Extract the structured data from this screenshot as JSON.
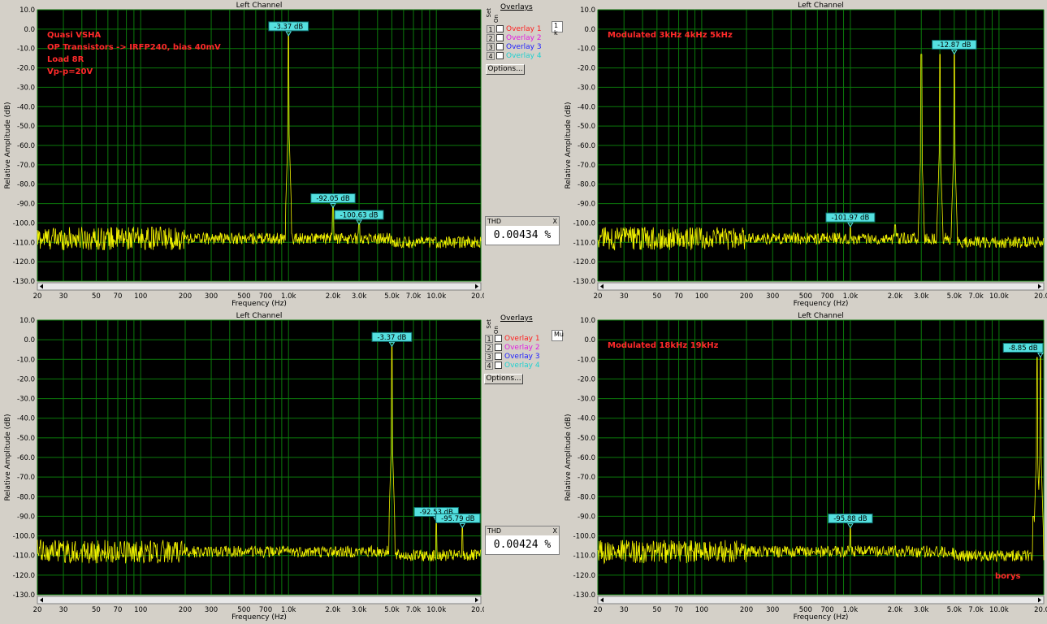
{
  "colors": {
    "plot_bg": "#000000",
    "grid": "#0b7a0b",
    "trace": "#f0f000",
    "marker": "#55e0e0",
    "annotation": "#ff2a2a"
  },
  "overlays": {
    "title": "Overlays",
    "set_label": "Set",
    "on_label": "On",
    "items": [
      {
        "num": "1",
        "label": "Overlay 1",
        "color": "#ff2020"
      },
      {
        "num": "2",
        "label": "Overlay 2",
        "color": "#e020e0"
      },
      {
        "num": "3",
        "label": "Overlay 3",
        "color": "#2020ff"
      },
      {
        "num": "4",
        "label": "Overlay 4",
        "color": "#20d0d0"
      }
    ],
    "options_label": "Options..."
  },
  "thd_top": {
    "label": "THD",
    "value": "0.00434 %",
    "close": "X"
  },
  "thd_bottom": {
    "label": "THD",
    "value": "0.00424 %",
    "close": "X"
  },
  "stub_top": "1 k",
  "stub_bottom": "Mu",
  "chart_data": [
    {
      "type": "line",
      "title": "Left Channel",
      "xlabel": "Frequency (Hz)",
      "ylabel": "Relative Amplitude (dB)",
      "xscale": "log",
      "xlim": [
        20,
        20000
      ],
      "ylim": [
        -130,
        10
      ],
      "xticks": [
        "20",
        "30",
        "50",
        "70",
        "100",
        "200",
        "300",
        "500",
        "700",
        "1.0k",
        "2.0k",
        "3.0k",
        "5.0k",
        "7.0k",
        "10.0k",
        "20.0k"
      ],
      "yticks": [
        "10.0",
        "0.0",
        "-10.0",
        "-20.0",
        "-30.0",
        "-40.0",
        "-50.0",
        "-60.0",
        "-70.0",
        "-80.0",
        "-90.0",
        "-100.0",
        "-110.0",
        "-120.0",
        "-130.0"
      ],
      "annotations": [
        "Quasi VSHA",
        "OP Transistors -> IRFP240, bias 40mV",
        "Load 8R",
        "Vp-p=20V"
      ],
      "markers": [
        {
          "x": 1000,
          "y": -3.37,
          "label": "-3.37 dB"
        },
        {
          "x": 2000,
          "y": -92.05,
          "label": "-92.05 dB"
        },
        {
          "x": 3000,
          "y": -100.63,
          "label": "-100.63 dB"
        }
      ],
      "peaks": [
        {
          "x": 1000,
          "y": -3.37
        },
        {
          "x": 2000,
          "y": -92.05
        },
        {
          "x": 3000,
          "y": -100.63
        }
      ],
      "noise_floor": -108
    },
    {
      "type": "line",
      "title": "Left Channel",
      "xlabel": "Frequency (Hz)",
      "ylabel": "Relative Amplitude (dB)",
      "xscale": "log",
      "xlim": [
        20,
        20000
      ],
      "ylim": [
        -130,
        10
      ],
      "xticks": [
        "20",
        "30",
        "50",
        "70",
        "100",
        "200",
        "300",
        "500",
        "700",
        "1.0k",
        "2.0k",
        "3.0k",
        "5.0k",
        "7.0k",
        "10.0k",
        "20.0k"
      ],
      "yticks": [
        "10.0",
        "0.0",
        "-10.0",
        "-20.0",
        "-30.0",
        "-40.0",
        "-50.0",
        "-60.0",
        "-70.0",
        "-80.0",
        "-90.0",
        "-100.0",
        "-110.0",
        "-120.0",
        "-130.0"
      ],
      "annotations": [
        "Modulated 3kHz 4kHz 5kHz"
      ],
      "markers": [
        {
          "x": 5000,
          "y": -12.87,
          "label": "-12.87 dB"
        },
        {
          "x": 1000,
          "y": -101.97,
          "label": "-101.97 dB"
        }
      ],
      "peaks": [
        {
          "x": 3000,
          "y": -13
        },
        {
          "x": 4000,
          "y": -13
        },
        {
          "x": 5000,
          "y": -12.87
        },
        {
          "x": 1000,
          "y": -101.97
        },
        {
          "x": 2000,
          "y": -101
        }
      ],
      "noise_floor": -108
    },
    {
      "type": "line",
      "title": "Left Channel",
      "xlabel": "Frequency (Hz)",
      "ylabel": "Relative Amplitude (dB)",
      "xscale": "log",
      "xlim": [
        20,
        20000
      ],
      "ylim": [
        -130,
        10
      ],
      "xticks": [
        "20",
        "30",
        "50",
        "70",
        "100",
        "200",
        "300",
        "500",
        "700",
        "1.0k",
        "2.0k",
        "3.0k",
        "5.0k",
        "7.0k",
        "10.0k",
        "20.0k"
      ],
      "yticks": [
        "10.0",
        "0.0",
        "-10.0",
        "-20.0",
        "-30.0",
        "-40.0",
        "-50.0",
        "-60.0",
        "-70.0",
        "-80.0",
        "-90.0",
        "-100.0",
        "-110.0",
        "-120.0",
        "-130.0"
      ],
      "annotations": [],
      "markers": [
        {
          "x": 5000,
          "y": -3.37,
          "label": "-3.37 dB"
        },
        {
          "x": 10000,
          "y": -92.53,
          "label": "-92.53 dB"
        },
        {
          "x": 15000,
          "y": -95.79,
          "label": "-95.79 dB"
        }
      ],
      "peaks": [
        {
          "x": 5000,
          "y": -3.37
        },
        {
          "x": 10000,
          "y": -92.53
        },
        {
          "x": 15000,
          "y": -95.79
        }
      ],
      "noise_floor": -108
    },
    {
      "type": "line",
      "title": "Left Channel",
      "xlabel": "Frequency (Hz)",
      "ylabel": "Relative Amplitude (dB)",
      "xscale": "log",
      "xlim": [
        20,
        20000
      ],
      "ylim": [
        -130,
        10
      ],
      "xticks": [
        "20",
        "30",
        "50",
        "70",
        "100",
        "200",
        "300",
        "500",
        "700",
        "1.0k",
        "2.0k",
        "3.0k",
        "5.0k",
        "7.0k",
        "10.0k",
        "20.0k"
      ],
      "yticks": [
        "10.0",
        "0.0",
        "-10.0",
        "-20.0",
        "-30.0",
        "-40.0",
        "-50.0",
        "-60.0",
        "-70.0",
        "-80.0",
        "-90.0",
        "-100.0",
        "-110.0",
        "-120.0",
        "-130.0"
      ],
      "annotations": [
        "Modulated 18kHz 19kHz",
        "borys"
      ],
      "markers": [
        {
          "x": 19000,
          "y": -8.85,
          "label": "-8.85 dB"
        },
        {
          "x": 1000,
          "y": -95.88,
          "label": "-95.88 dB"
        }
      ],
      "peaks": [
        {
          "x": 18000,
          "y": -9
        },
        {
          "x": 19000,
          "y": -8.85
        },
        {
          "x": 1000,
          "y": -95.88
        },
        {
          "x": 17000,
          "y": -90
        }
      ],
      "noise_floor": -108
    }
  ]
}
